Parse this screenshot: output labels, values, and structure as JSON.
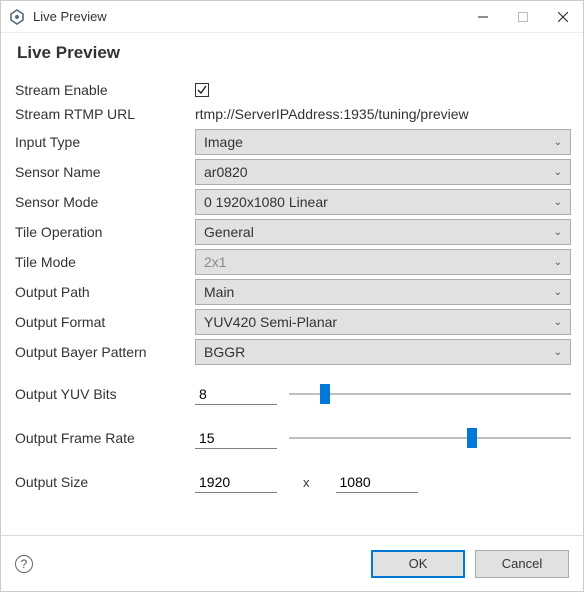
{
  "window": {
    "title": "Live Preview",
    "heading": "Live Preview"
  },
  "fields": {
    "stream_enable": {
      "label": "Stream Enable",
      "checked": true
    },
    "stream_rtmp_url": {
      "label": "Stream RTMP URL",
      "value": "rtmp://ServerIPAddress:1935/tuning/preview"
    },
    "input_type": {
      "label": "Input Type",
      "value": "Image"
    },
    "sensor_name": {
      "label": "Sensor Name",
      "value": "ar0820"
    },
    "sensor_mode": {
      "label": "Sensor Mode",
      "value": "0 1920x1080 Linear"
    },
    "tile_operation": {
      "label": "Tile Operation",
      "value": "General"
    },
    "tile_mode": {
      "label": "Tile Mode",
      "value": "2x1",
      "disabled": true
    },
    "output_path": {
      "label": "Output Path",
      "value": "Main"
    },
    "output_format": {
      "label": "Output Format",
      "value": "YUV420 Semi-Planar"
    },
    "output_bayer_pattern": {
      "label": "Output Bayer Pattern",
      "value": "BGGR"
    },
    "output_yuv_bits": {
      "label": "Output YUV Bits",
      "value": "8",
      "slider_pct": 11
    },
    "output_frame_rate": {
      "label": "Output Frame Rate",
      "value": "15",
      "slider_pct": 63
    },
    "output_size": {
      "label": "Output Size",
      "w": "1920",
      "sep": "x",
      "h": "1080"
    }
  },
  "footer": {
    "ok": "OK",
    "cancel": "Cancel"
  }
}
